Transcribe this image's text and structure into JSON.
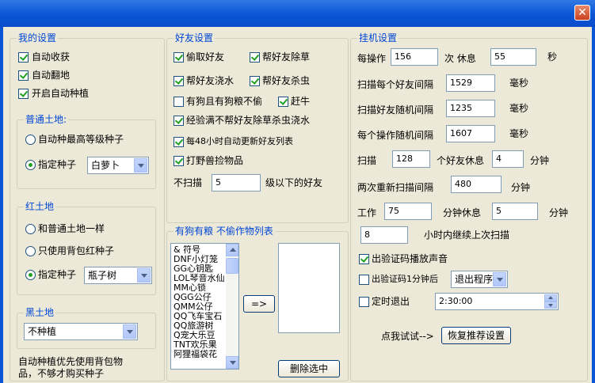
{
  "colors": {
    "titlebar": "#0a55d6",
    "group_title": "#0046d5",
    "client_bg": "#ece9d8",
    "check": "#21a121"
  },
  "window": {
    "close_glyph": "✕"
  },
  "my_settings": {
    "title": "我的设置",
    "auto_harvest": "自动收获",
    "auto_plow": "自动翻地",
    "auto_plant": "开启自动种植"
  },
  "normal_land": {
    "title": "普通土地:",
    "opt_highest": "自动种最高等级种子",
    "opt_specified": "指定种子",
    "seed_value": "白萝卜"
  },
  "red_land": {
    "title": "红土地",
    "opt_same": "和普通土地一样",
    "opt_backpack": "只使用背包红种子",
    "opt_specified": "指定种子",
    "seed_value": "瓶子树"
  },
  "black_land": {
    "title": "黑土地",
    "value": "不种植"
  },
  "note": {
    "line1": "自动种植优先使用背包物",
    "line2": "品，不够才购买种子"
  },
  "friend_settings": {
    "title": "好友设置",
    "steal": "偷取好友",
    "weed": "帮好友除草",
    "water": "帮好友浇水",
    "kill_bug": "帮好友杀虫",
    "dog_no_steal": "有狗且有狗粮不偷",
    "chase_cow": "赶牛",
    "exp_full": "经验满不帮好友除草杀虫浇水",
    "auto_update": "每48小时自动更新好友列表",
    "beast": "打野兽捡物品",
    "skip_prefix": "不扫描",
    "skip_level": "5",
    "skip_suffix": "级以下的好友"
  },
  "dog_list": {
    "title": "有狗有粮 不偷作物列表",
    "items": [
      "& 符号",
      "DNF小灯笼",
      "GG心钥匙",
      "LOL琴音水仙",
      "MM心锁",
      "QGG公仔",
      "QMM公仔",
      "QQ飞车宝石",
      "QQ旅游树",
      "Q宠大乐豆",
      "TNT欢乐果",
      "阿狸福袋花"
    ],
    "add_button": "=>",
    "delete_button": "删除选中"
  },
  "hang_settings": {
    "title": "挂机设置",
    "ops_label": "每操作",
    "ops_value": "156",
    "rest_label": "次 休息",
    "rest_value": "55",
    "sec_unit": "秒",
    "scan_friend_label": "扫描每个好友间隔",
    "scan_friend_value": "1529",
    "ms1": "毫秒",
    "scan_random_label": "扫描好友随机间隔",
    "scan_random_value": "1235",
    "ms2": "毫秒",
    "op_random_label": "每个操作随机间隔",
    "op_random_value": "1607",
    "ms3": "毫秒",
    "scan_label": "扫描",
    "scan_count": "128",
    "scan_mid": "个好友休息",
    "scan_rest": "4",
    "min1": "分钟",
    "rescan_label": "两次重新扫描间隔",
    "rescan_value": "480",
    "min2": "分钟",
    "work_label": "工作",
    "work_value": "75",
    "work_mid": "分钟休息",
    "work_rest": "5",
    "min3": "分钟",
    "resume_value": "8",
    "resume_label": "小时内继续上次扫描",
    "captcha_sound": "出验证码播放声音",
    "captcha_after": "出验证码1分钟后",
    "captcha_action": "退出程序",
    "timed_exit": "定时退出",
    "timed_value": "2:30:00",
    "try_label": "点我试试-->",
    "restore_button": "恢复推荐设置"
  }
}
